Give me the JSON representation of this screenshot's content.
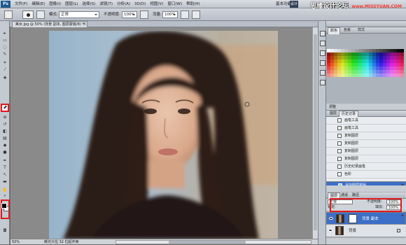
{
  "app": {
    "logo": "Ps"
  },
  "menu": [
    "文件(F)",
    "编辑(E)",
    "图像(I)",
    "图层(L)",
    "选择(S)",
    "滤镜(T)",
    "分析(A)",
    "3D(D)",
    "视图(V)",
    "窗口(W)",
    "帮助(H)"
  ],
  "workspace": {
    "basic": "基本功能",
    "design": "设计"
  },
  "watermark": {
    "site": "思缘设计论坛",
    "url": "www.MISSYUAN.COM"
  },
  "options": {
    "mode_label": "模式:",
    "mode_value": "正常",
    "opacity_label": "不透明度:",
    "opacity_value": "100%",
    "flow_label": "流量:",
    "flow_value": "100%"
  },
  "document": {
    "tab_title": "美女.jpg @ 50% (背景 副本, 图层蒙版/8) *",
    "close": "×"
  },
  "status": {
    "zoom": "50%",
    "text": "曝光只在 32 位起作用"
  },
  "panels": {
    "color_tabs": [
      "颜色",
      "色板",
      "样式"
    ],
    "adjust_tab": "调整",
    "history_tabs": [
      "图层",
      "历史记录"
    ],
    "history_items": [
      "画笔工具",
      "画笔工具",
      "复制图层",
      "复制图层",
      "复制图层",
      "复制图层",
      "历史纪录画笔",
      "色阶",
      "添加图层蒙版"
    ],
    "history_selected": 8,
    "layers_tabs": [
      "图层",
      "通道",
      "路径"
    ],
    "blend_mode": "正常",
    "opacity_label": "不透明度:",
    "opacity_value": "100%",
    "lock_label": "锁定:",
    "fill_label": "填充:",
    "fill_value": "100%",
    "layers": [
      {
        "name": "背景 副本",
        "selected": true,
        "mask": true
      },
      {
        "name": "背景",
        "selected": false,
        "mask": false
      }
    ]
  },
  "colors": {
    "foreground": "#000000",
    "background": "#ffffff",
    "highlight": "#e3171c",
    "selection": "#3c6fc7"
  }
}
